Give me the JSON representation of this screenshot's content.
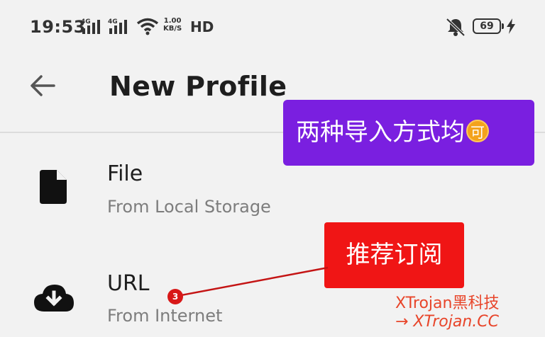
{
  "status_bar": {
    "time": "19:53",
    "network_a": "4G",
    "network_b": "4G",
    "speed_value": "1.00",
    "speed_unit": "KB/S",
    "hd_label": "HD",
    "battery": "69"
  },
  "app_bar": {
    "title": "New Profile"
  },
  "items": [
    {
      "title": "File",
      "subtitle": "From Local Storage"
    },
    {
      "title": "URL",
      "subtitle": "From Internet"
    }
  ],
  "annotations": {
    "banner_top": "两种导入方式均",
    "banner_top_coin": "可",
    "banner_recommend": "推荐订阅",
    "badge_number": "3",
    "watermark_line1": "XTrojan黑科技",
    "watermark_line2": "→ XTrojan.CC"
  },
  "colors": {
    "purple_banner": "#7a1fe0",
    "red_banner": "#f01515",
    "watermark": "#e8452a"
  }
}
